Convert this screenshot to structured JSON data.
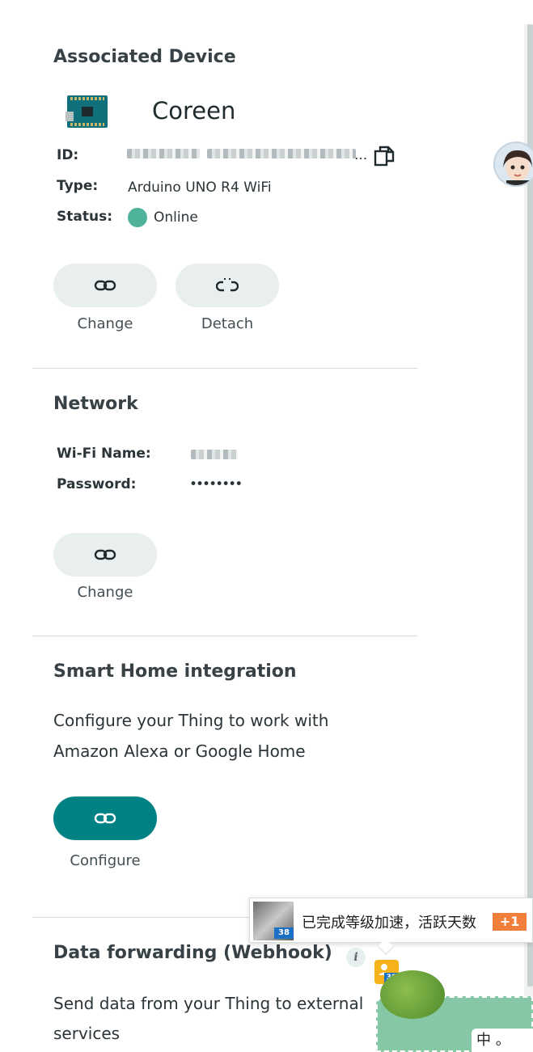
{
  "associated_device": {
    "title": "Associated Device",
    "device_name": "Coreen",
    "id_label": "ID:",
    "id_value_ellipsis": "...",
    "type_label": "Type:",
    "type_value": "Arduino UNO R4 WiFi",
    "status_label": "Status:",
    "status_value": "Online",
    "status_color": "#4fb39c",
    "change_label": "Change",
    "detach_label": "Detach"
  },
  "network": {
    "title": "Network",
    "wifi_label": "Wi-Fi Name:",
    "password_label": "Password:",
    "password_value": "••••••••",
    "change_label": "Change"
  },
  "smart_home": {
    "title": "Smart Home integration",
    "description_line1": "Configure your Thing to work with",
    "description_line2": "Amazon Alexa or Google Home",
    "configure_label": "Configure",
    "accent_color": "#008184"
  },
  "data_forwarding": {
    "title": "Data forwarding (Webhook)",
    "info_icon_glyph": "i",
    "description_line1": "Send data from your Thing to external",
    "description_line2": "services"
  },
  "overlay_toast": {
    "badge": "38",
    "text": "已完成等级加速，活跃天数",
    "plus": "+1"
  },
  "mini_badge": {
    "badge": "38"
  },
  "ime_indicator": {
    "text": "中 。"
  },
  "icons": {
    "link": "link-icon",
    "unlink": "unlink-icon",
    "copy": "copy-icon",
    "info": "info-icon"
  }
}
